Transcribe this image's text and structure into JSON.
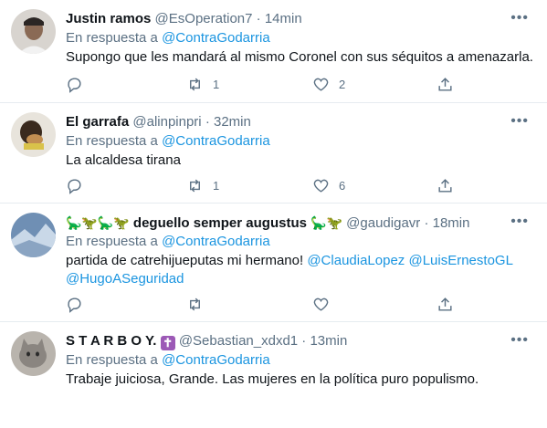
{
  "reply_prefix": "En respuesta a",
  "tweets": [
    {
      "name": "Justin ramos",
      "handle": "@EsOperation7",
      "time": "14min",
      "reply_to": "@ContraGodarria",
      "text": "Supongo que les mandará al mismo Coronel con sus séquitos a amenazarla.",
      "retweets": "1",
      "likes": "2"
    },
    {
      "name": "El garrafa",
      "handle": "@alinpinpri",
      "time": "32min",
      "reply_to": "@ContraGodarria",
      "text": "La alcaldesa tirana",
      "retweets": "1",
      "likes": "6"
    },
    {
      "name_prefix_emoji": "🦕🦖🦕🦖",
      "name": "deguello semper augustus",
      "name_suffix_emoji": "🦕🦖",
      "handle": "@gaudigavr",
      "time": "18min",
      "reply_to": "@ContraGodarria",
      "text": "partida de catrehijueputas mi hermano!",
      "mentions": [
        "@ClaudiaLopez",
        "@LuisErnestoGL",
        "@HugoASeguridad"
      ],
      "retweets": "",
      "likes": ""
    },
    {
      "name": "S T A R B O Y.",
      "name_suffix_emoji": "✝",
      "handle": "@Sebastian_xdxd1",
      "time": "13min",
      "reply_to": "@ContraGodarria",
      "text": "Trabaje juiciosa, Grande. Las mujeres en la política puro populismo.",
      "retweets": "",
      "likes": ""
    }
  ],
  "icons": {
    "more": "more-options-icon",
    "reply": "reply-icon",
    "retweet": "retweet-icon",
    "like": "heart-icon",
    "share": "share-icon"
  },
  "colors": {
    "link": "#1b95e0",
    "secondary_text": "#5b7083",
    "divider": "#e6ecf0"
  }
}
